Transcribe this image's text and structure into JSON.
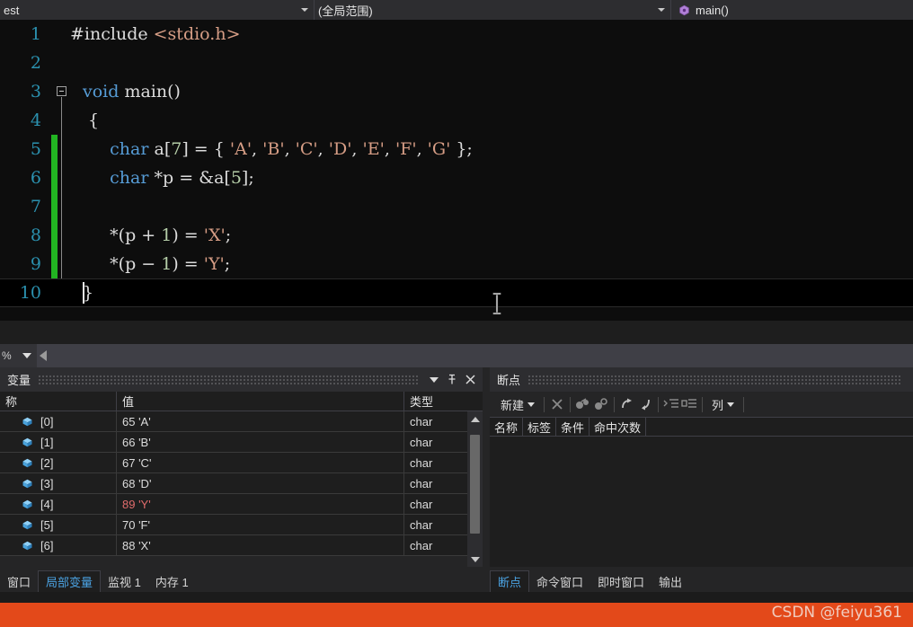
{
  "navbar": {
    "project_combo": "est",
    "scope_combo": "(全局范围)",
    "member_combo": "main()",
    "member_icon": "method-icon",
    "dropdown_icon": "chevron-down-icon"
  },
  "editor": {
    "lines": [
      {
        "num": "1",
        "text": "#include <stdio.h>"
      },
      {
        "num": "2",
        "text": ""
      },
      {
        "num": "3",
        "text": "void main()"
      },
      {
        "num": "4",
        "text": "{"
      },
      {
        "num": "5",
        "text": "char a[7] = { 'A', 'B', 'C', 'D', 'E', 'F', 'G' };"
      },
      {
        "num": "6",
        "text": "char *p = &a[5];"
      },
      {
        "num": "7",
        "text": ""
      },
      {
        "num": "8",
        "text": "*(p + 1) = 'X';"
      },
      {
        "num": "9",
        "text": "*(p - 1) = 'Y';"
      },
      {
        "num": "10",
        "text": "}"
      }
    ],
    "current_line": "10",
    "fold_icon": "collapse-box-icon",
    "mouse_cursor_icon": "text-ibeam-cursor"
  },
  "strip": {
    "zoom_level": "%",
    "back_icon": "nav-back-icon"
  },
  "variables_panel": {
    "title": "变量",
    "dropdown_icon": "chevron-down-icon",
    "pin_icon": "pin-icon",
    "close_icon": "close-icon",
    "columns": [
      "称",
      "值",
      "类型"
    ],
    "rows": [
      {
        "icon": "variable-icon",
        "name": "[0]",
        "value": "65 'A'",
        "type": "char",
        "changed": false
      },
      {
        "icon": "variable-icon",
        "name": "[1]",
        "value": "66 'B'",
        "type": "char",
        "changed": false
      },
      {
        "icon": "variable-icon",
        "name": "[2]",
        "value": "67 'C'",
        "type": "char",
        "changed": false
      },
      {
        "icon": "variable-icon",
        "name": "[3]",
        "value": "68 'D'",
        "type": "char",
        "changed": false
      },
      {
        "icon": "variable-icon",
        "name": "[4]",
        "value": "89 'Y'",
        "type": "char",
        "changed": true
      },
      {
        "icon": "variable-icon",
        "name": "[5]",
        "value": "70 'F'",
        "type": "char",
        "changed": false
      },
      {
        "icon": "variable-icon",
        "name": "[6]",
        "value": "88 'X'",
        "type": "char",
        "changed": false
      }
    ],
    "scroll_up_icon": "scroll-up-icon",
    "scroll_down_icon": "scroll-down-icon",
    "changed_value_color": "#e06c6c"
  },
  "breakpoints_panel": {
    "title": "断点",
    "toolbar": {
      "new_label": "新建",
      "delete_icon": "delete-x-icon",
      "disable_all_icon": "disable-all-breakpoints-icon",
      "toggle_icon": "toggle-breakpoint-icon",
      "export_icon": "export-breakpoints-icon",
      "import_icon": "import-breakpoints-icon",
      "expand_icon": "expand-all-icon",
      "collapse_icon": "collapse-all-icon",
      "columns_label": "列"
    },
    "columns": [
      "名称",
      "标签",
      "条件",
      "命中次数"
    ],
    "rows": []
  },
  "bottom_tabs_left": [
    {
      "label": "窗口",
      "active": false
    },
    {
      "label": "局部变量",
      "active": true
    },
    {
      "label": "监视 1",
      "active": false
    },
    {
      "label": "内存 1",
      "active": false
    }
  ],
  "bottom_tabs_right": [
    {
      "label": "断点",
      "active": true
    },
    {
      "label": "命令窗口",
      "active": false
    },
    {
      "label": "即时窗口",
      "active": false
    },
    {
      "label": "输出",
      "active": false
    }
  ],
  "watermark": {
    "text": "CSDN @feiyu361",
    "bar_color": "#e3491a"
  }
}
